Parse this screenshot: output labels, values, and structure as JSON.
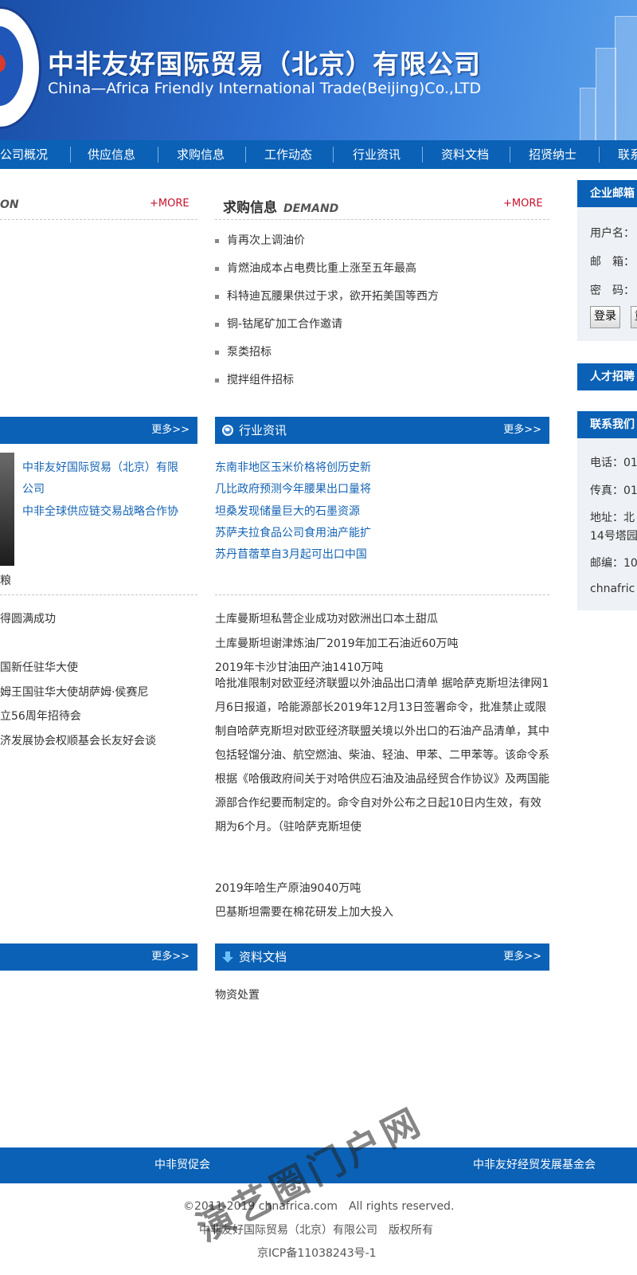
{
  "header": {
    "title_cn": "中非友好国际贸易（北京）有限公司",
    "title_en": "China—Africa Friendly International Trade(Beijing)Co.,LTD"
  },
  "nav": {
    "items": [
      "公司概况",
      "供应信息",
      "求购信息",
      "工作动态",
      "行业资讯",
      "资料文档",
      "招贤纳士",
      "联系"
    ]
  },
  "supply": {
    "head_en_tail": "ON",
    "more": "+MORE"
  },
  "demand": {
    "title": "求购信息",
    "title_en": "DEMAND",
    "more": "+MORE",
    "items": [
      "肯再次上调油价",
      "肯燃油成本占电费比重上涨至五年最高",
      "科特迪瓦腰果供过于求，欲开拓美国等西方",
      "铜-钴尾矿加工合作邀请",
      "泵类招标",
      "搅拌组件招标"
    ]
  },
  "work": {
    "more": "更多>>",
    "photo_items": [
      "中非友好国际贸易（北京）有限",
      "公司",
      "中非全球供应链交易战略合作协"
    ],
    "caption": "粮",
    "items": [
      "得圆满成功",
      "国新任驻华大使",
      "姆王国驻华大使胡萨姆·侯赛尼",
      "立56周年招待会",
      "济发展协会权顺基会长友好会谈"
    ]
  },
  "industry": {
    "title": "行业资讯",
    "more": "更多>>",
    "blue_items": [
      "东南非地区玉米价格将创历史新",
      "几比政府预测今年腰果出口量将",
      "坦桑发现储量巨大的石墨资源",
      "苏萨夫拉食品公司食用油产能扩",
      "苏丹苜蓿草自3月起可出口中国"
    ],
    "items": [
      "土库曼斯坦私营企业成功对欧洲出口本土甜瓜",
      "土库曼斯坦谢津炼油厂2019年加工石油近60万吨",
      "2019年卡沙甘油田产油1410万吨"
    ],
    "article": "哈批准限制对欧亚经济联盟以外油品出口清单 据哈萨克斯坦法律网1月6日报道，哈能源部长2019年12月13日签署命令，批准禁止或限制自哈萨克斯坦对欧亚经济联盟关境以外出口的石油产品清单，其中包括轻馏分油、航空燃油、柴油、轻油、甲苯、二甲苯等。该命令系根据《哈俄政府间关于对哈供应石油及油品经贸合作协议》及两国能源部合作纪要而制定的。命令自对外公布之日起10日内生效，有效期为6个月。（驻哈萨克斯坦使",
    "items_after": [
      "2019年哈生产原油9040万吨",
      "巴基斯坦需要在棉花研发上加大投入"
    ]
  },
  "left_bottom": {
    "more": "更多>>"
  },
  "docs": {
    "title": "资料文档",
    "more": "更多>>",
    "items": [
      "物资处置"
    ]
  },
  "right": {
    "mail_title": "企业邮箱",
    "username_label": "用户名：",
    "mailbox_label": "邮　箱：",
    "password_label": "密　码：",
    "login_label": "登录",
    "reset_label": "重",
    "talent_title": "人才招聘",
    "contact_title": "联系我们",
    "phone": "电话：01",
    "fax": "传真：01",
    "address_1": "地址：北",
    "address_2": "14号塔园",
    "postcode": "邮编：10",
    "email": "chnafric"
  },
  "footer": {
    "links": [
      "中非贸促会",
      "中非友好经贸发展基金会"
    ],
    "copyright": "©2011-2019 chnafrica.com　All rights reserved.",
    "company": "中非友好国际贸易（北京）有限公司　版权所有",
    "icp": "京ICP备11038243号-1"
  },
  "watermark": "演艺圈门户网"
}
